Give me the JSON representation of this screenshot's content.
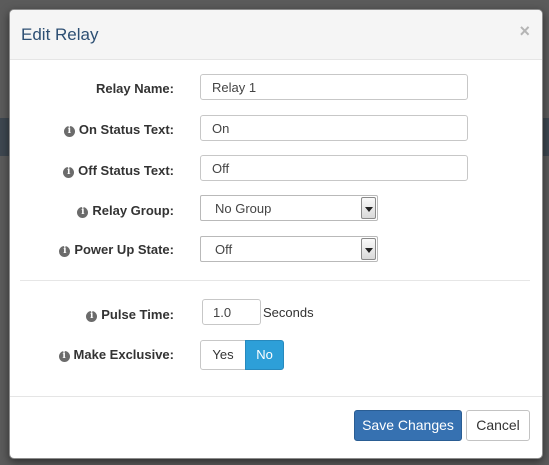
{
  "dialog": {
    "title": "Edit Relay",
    "close_glyph": "×"
  },
  "form": {
    "relay_name": {
      "label": "Relay Name:",
      "value": "Relay 1"
    },
    "on_status_text": {
      "label": "On Status Text:",
      "value": "On",
      "info_icon": "info-icon"
    },
    "off_status_text": {
      "label": "Off Status Text:",
      "value": "Off",
      "info_icon": "info-icon"
    },
    "relay_group": {
      "label": "Relay Group:",
      "selected": "No Group",
      "info_icon": "info-icon"
    },
    "power_up_state": {
      "label": "Power Up State:",
      "selected": "Off",
      "info_icon": "info-icon"
    },
    "pulse_time": {
      "label": "Pulse Time:",
      "value": "1.0",
      "unit": "Seconds",
      "info_icon": "info-icon"
    },
    "make_exclusive": {
      "label": "Make Exclusive:",
      "options": [
        "Yes",
        "No"
      ],
      "selected": "No",
      "info_icon": "info-icon"
    }
  },
  "footer": {
    "save_label": "Save Changes",
    "cancel_label": "Cancel"
  },
  "colors": {
    "primary_button": "#3671b1",
    "toggle_active": "#2d9fd8",
    "title_text": "#2d4f73"
  }
}
